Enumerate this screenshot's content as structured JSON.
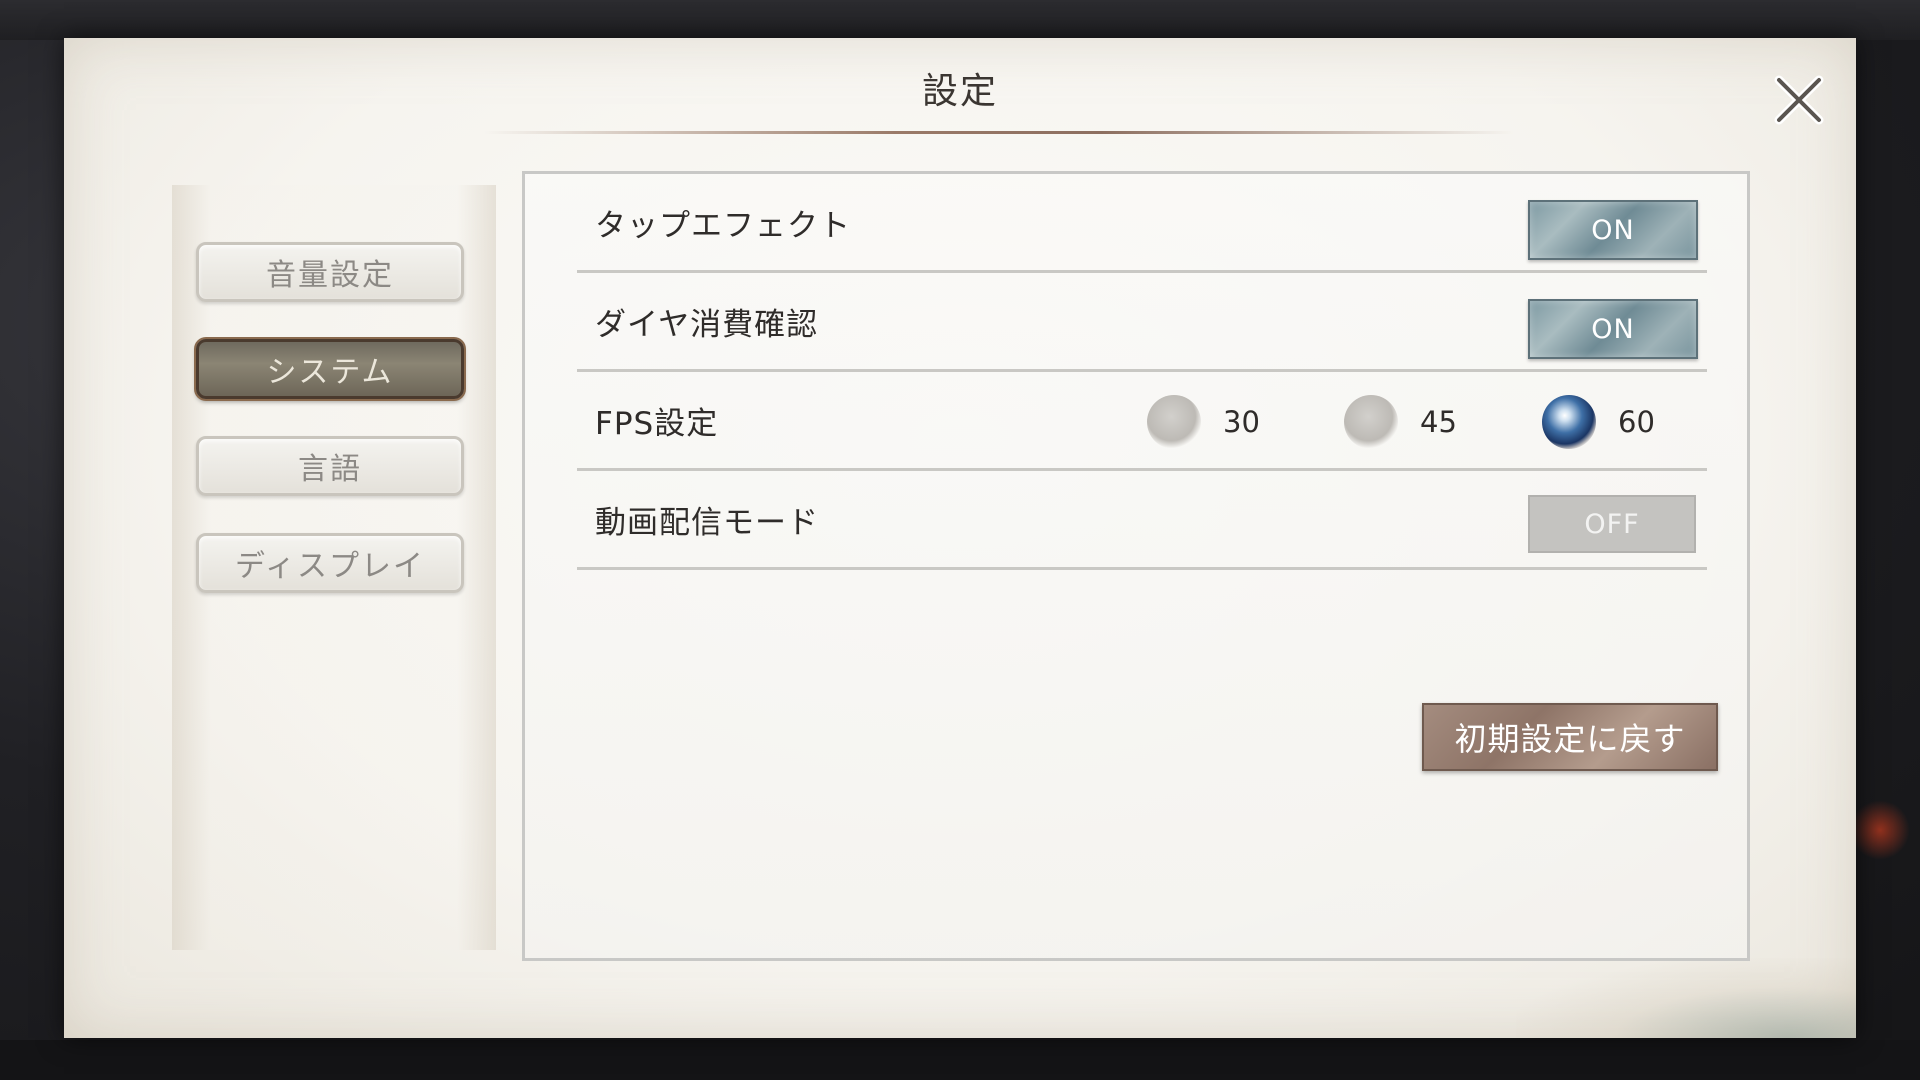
{
  "dialog": {
    "title": "設定"
  },
  "sidebar": {
    "tabs": [
      {
        "label": "音量設定",
        "active": false
      },
      {
        "label": "システム",
        "active": true
      },
      {
        "label": "言語",
        "active": false
      },
      {
        "label": "ディスプレイ",
        "active": false
      }
    ]
  },
  "settings": {
    "tap_effect": {
      "label": "タップエフェクト",
      "value": "ON"
    },
    "diamond_confirm": {
      "label": "ダイヤ消費確認",
      "value": "ON"
    },
    "fps": {
      "label": "FPS設定",
      "options": [
        "30",
        "45",
        "60"
      ],
      "selected": "60"
    },
    "streaming_mode": {
      "label": "動画配信モード",
      "value": "OFF"
    }
  },
  "reset_button": {
    "label": "初期設定に戻す"
  },
  "colors": {
    "toggle_on": "#8aa4ac",
    "toggle_off": "#c4c3c0",
    "active_tab": "#7a7466",
    "reset_button": "#9c8477"
  },
  "icons": {
    "close": "close-x-icon",
    "radio_selected": "blue-orb-icon"
  }
}
